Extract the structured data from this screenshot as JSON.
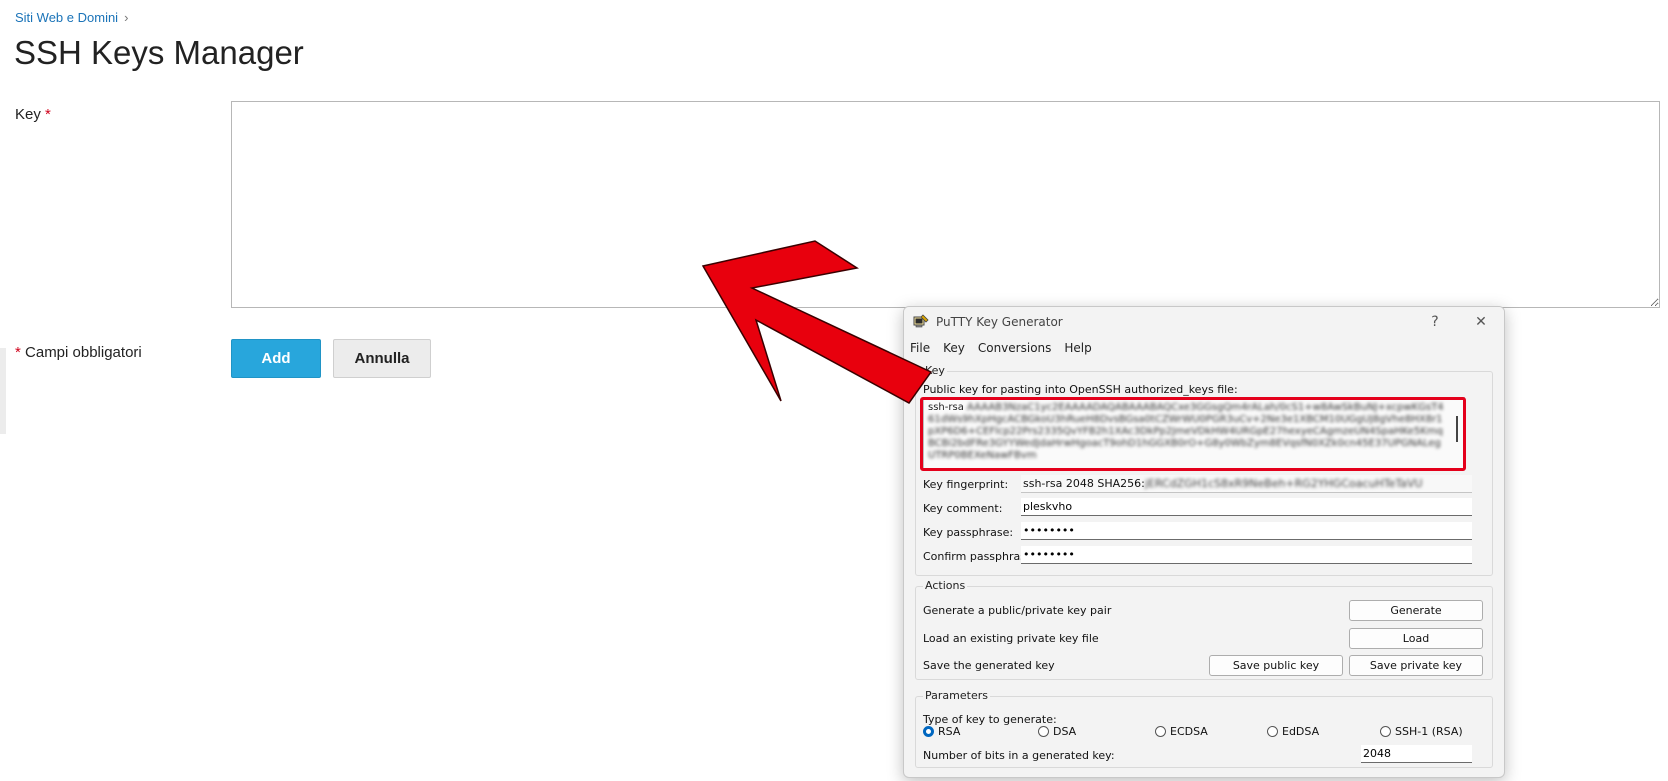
{
  "breadcrumb": {
    "item": "Siti Web e Domini"
  },
  "page": {
    "title": "SSH Keys Manager"
  },
  "form": {
    "key_label": "Key",
    "required_mark": "*",
    "key_value": "",
    "required_note": "Campi obbligatori",
    "add_label": "Add",
    "cancel_label": "Annulla"
  },
  "putty": {
    "title": "PuTTY Key Generator",
    "help_glyph": "?",
    "close_glyph": "✕",
    "menu": [
      "File",
      "Key",
      "Conversions",
      "Help"
    ],
    "key_group": "Key",
    "public_key_label": "Public key for pasting into OpenSSH authorized_keys file:",
    "public_key_prefix": "ssh-rsa",
    "public_key_blurred": "AAAAB3NzaC1yc2EAAAADAQABAAABAQCxe3GGsgQm4rALah/0cS1+w8AwSkBuNJ+xcpwKGsT461dWs9hXpHgcACBGkoU3hRueH8DvsBGsa0tCZWrWU0PGR3uCv+2Ne3e1XBCM10UGgUJ8gVhe8HX8r1pXP6D6+CEFlcp22Prs2335QvYFB2h1XAc3DkPp2JmeVDkHW4URGpE27hexyeCAgmzeUN4SpaHKe5KmqBCBi2bdFRe3GYYWedJdaHrwHgoacT9ohD1hGGXB0rO+G8y0WbZym8EVqsfN0XZk0cn45E37UPGNALegUTRP0BEXeNawFBvm",
    "fingerprint_label": "Key fingerprint:",
    "fingerprint_prefix": "ssh-rsa 2048 SHA256:",
    "fingerprint_blurred": "jERCdZGH1cS8xR9NeBeh+RG2YHGCoacuHTeTaVU",
    "comment_label": "Key comment:",
    "comment_value": "pleskvho",
    "passphrase_label": "Key passphrase:",
    "passphrase_value": "••••••••",
    "confirm_label": "Confirm passphrase:",
    "confirm_value": "••••••••",
    "actions_group": "Actions",
    "generate_text": "Generate a public/private key pair",
    "generate_btn": "Generate",
    "load_text": "Load an existing private key file",
    "load_btn": "Load",
    "save_text": "Save the generated key",
    "save_public_btn": "Save public key",
    "save_private_btn": "Save private key",
    "params_group": "Parameters",
    "type_label": "Type of key to generate:",
    "types": [
      "RSA",
      "DSA",
      "ECDSA",
      "EdDSA",
      "SSH-1 (RSA)"
    ],
    "selected_type": "RSA",
    "bits_label": "Number of bits in a generated key:",
    "bits_value": "2048"
  },
  "annotation": {
    "arrow_color": "#e8000d",
    "highlight_color": "#e4001b"
  }
}
